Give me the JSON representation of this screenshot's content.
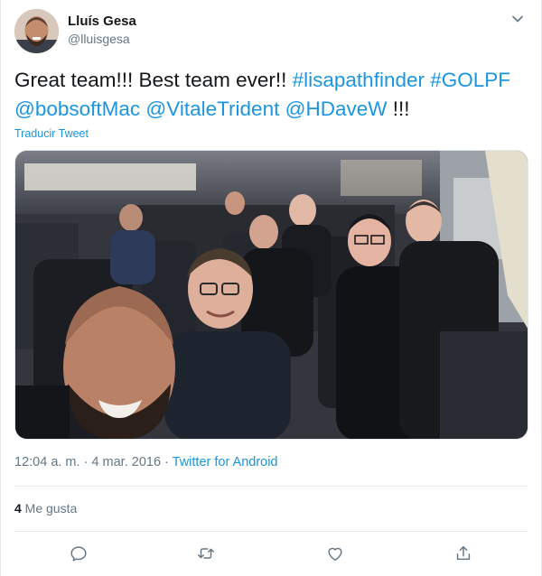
{
  "user": {
    "display_name": "Lluís Gesa",
    "handle": "@lluisgesa"
  },
  "tweet": {
    "text_parts": [
      {
        "text": "Great team!!! Best team ever!! ",
        "link": false
      },
      {
        "text": "#lisapathfinder",
        "link": true
      },
      {
        "text": " ",
        "link": false
      },
      {
        "text": "#GOLPF",
        "link": true
      },
      {
        "text": " ",
        "link": false
      },
      {
        "text": "@bobsoftMac",
        "link": true
      },
      {
        "text": " ",
        "link": false
      },
      {
        "text": "@VitaleTrident",
        "link": true
      },
      {
        "text": " ",
        "link": false
      },
      {
        "text": "@HDaveW",
        "link": true
      },
      {
        "text": " !!!",
        "link": false
      }
    ],
    "translate_label": "Traducir Tweet",
    "time": "12:04 a. m.",
    "separator": " · ",
    "date": "4 mar. 2016",
    "source": "Twitter for Android",
    "likes_count": "4",
    "likes_label": " Me gusta"
  },
  "icons": {
    "menu": "chevron-down-icon",
    "reply": "reply-icon",
    "retweet": "retweet-icon",
    "like": "heart-icon",
    "share": "share-icon"
  },
  "colors": {
    "link": "#1b95e0",
    "secondary_text": "#657786",
    "primary_text": "#14171a",
    "border": "#e6ecf0"
  }
}
